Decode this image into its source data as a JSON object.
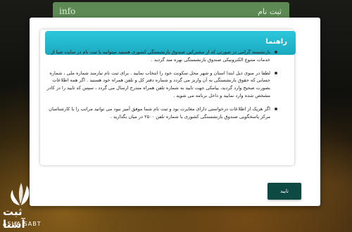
{
  "background_tab": {
    "left_label": "info",
    "right_label": "ثبت نام"
  },
  "modal": {
    "header_title": "راهنما",
    "paragraphs": [
      "بازنشسته گرامی در صورتی که از مشترکین صندوق بازنشستگی کشوری هستید میتوانید با ثبت نام در سایت صبا از خدمات متنوع الکترونیکی صندوق بازنشستگی بهره مند گردید .",
      "لطفا در منوی ذیل ابتدا استان و شهر محل سکونت خود را انتخاب نمایید . برای ثبت نام نیازمند شماره ملی ، شماره حسابی که حقوق بازنشستگی به آن واریز می گردد و شماره دفتر کل و تلفن همراه خود هستید . اگر همه اطلاعات بصورت صحیح وارد گردید، پیامکی جهت تایید به شماره تلفن همراه مندرج ارسال می گردد ، سپس کد تایید را در کادر مشخص شده وارد نمایید و داخل برنامه می شوید .",
      "اگر هریک از اطلاعات درخواستی دارای مغایرت بود و ثبت نام شما موفق آمیز نبود می توانید مراتب را با کارشناسان مرکز پاسخگویی صندوق بازنشستگی کشوری با شماره تلفن ۲۵۰۰ در میان بگذارید ."
    ],
    "confirm_label": "تایید"
  },
  "logo": {
    "text_fa": "ثبت آشنا",
    "text_en": "ASHA SABT"
  }
}
